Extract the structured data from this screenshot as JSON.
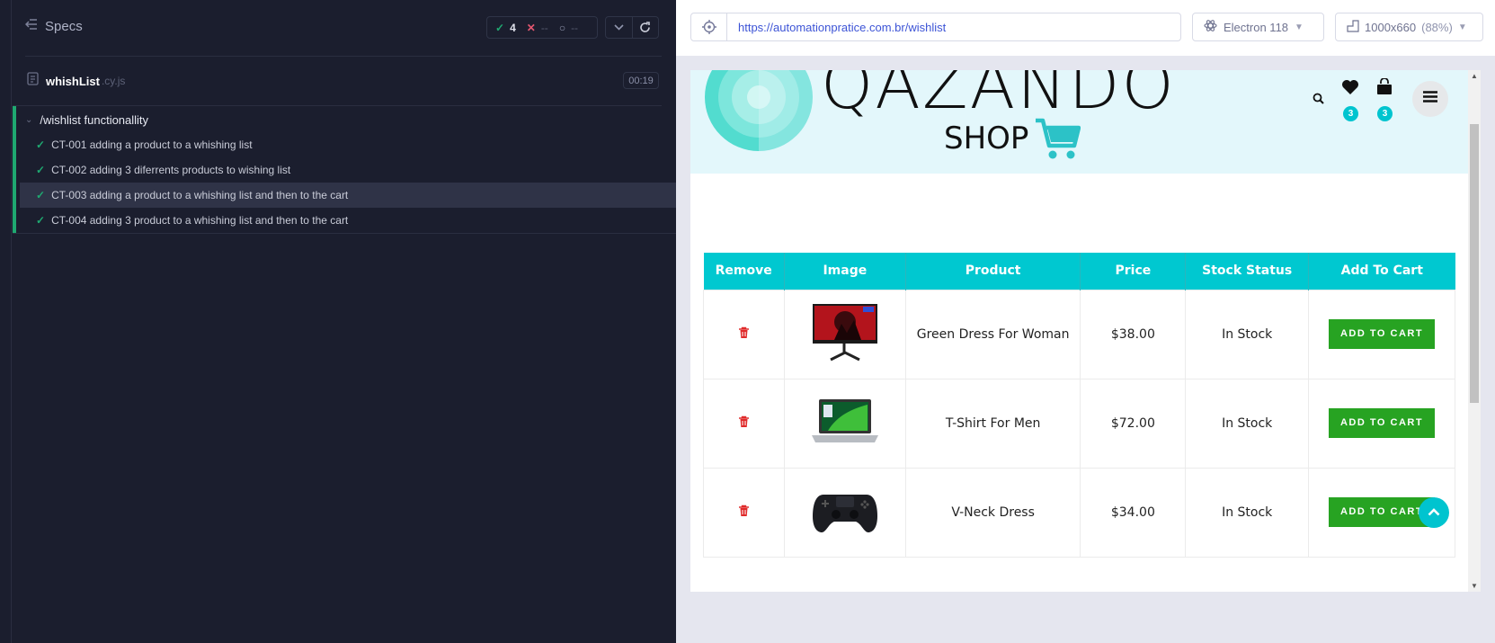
{
  "runner": {
    "specs_label": "Specs",
    "stats": {
      "passed": "4",
      "failed": "--",
      "pending": "--"
    },
    "file": {
      "name": "whishList",
      "ext": ".cy.js",
      "duration": "00:19"
    },
    "suite": {
      "title": "/wishlist functionallity",
      "tests": [
        {
          "label": "CT-001 adding a product to a whishing list"
        },
        {
          "label": "CT-002 adding 3 diferrents products to wishing list"
        },
        {
          "label": "CT-003 adding a product to a whishing list and then to the cart"
        },
        {
          "label": "CT-004 adding 3 product to a whishing list and then to the cart"
        }
      ]
    },
    "url": "https://automationpratice.com.br/wishlist",
    "browser": "Electron 118",
    "viewport": "1000x660",
    "viewport_scale": "(88%)"
  },
  "shop": {
    "logo_text": "QAZANDO",
    "shop_text": "SHOP",
    "wishlist_count": "3",
    "cart_count": "3",
    "table": {
      "headers": [
        "Remove",
        "Image",
        "Product",
        "Price",
        "Stock Status",
        "Add To Cart"
      ],
      "rows": [
        {
          "product": "Green Dress For Woman",
          "price": "$38.00",
          "stock": "In Stock",
          "button": "ADD TO CART",
          "image": "monitor"
        },
        {
          "product": "T-Shirt For Men",
          "price": "$72.00",
          "stock": "In Stock",
          "button": "ADD TO CART",
          "image": "laptop"
        },
        {
          "product": "V-Neck Dress",
          "price": "$34.00",
          "stock": "In Stock",
          "button": "ADD TO CART",
          "image": "gamepad"
        }
      ]
    }
  },
  "colors": {
    "accent": "#00c8d0",
    "pass": "#1fa971",
    "add_to_cart": "#27a322",
    "trash": "#e02b2b"
  }
}
